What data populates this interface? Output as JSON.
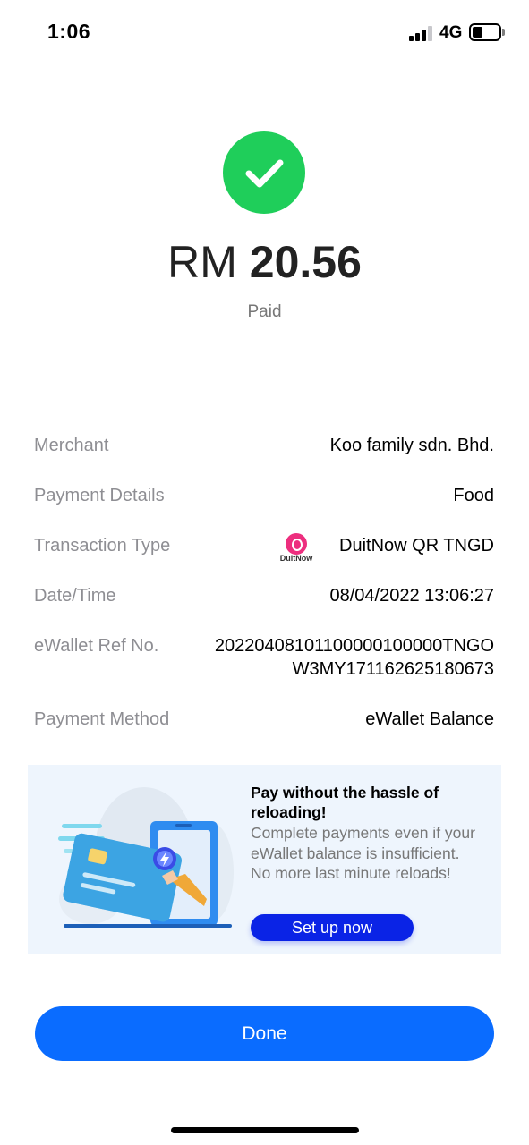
{
  "status_bar": {
    "time": "1:06",
    "network": "4G",
    "battery_level": 0.4
  },
  "payment": {
    "currency": "RM",
    "amount": "20.56",
    "status": "Paid"
  },
  "details": {
    "merchant_label": "Merchant",
    "merchant_value": "Koo family sdn. Bhd.",
    "payment_details_label": "Payment Details",
    "payment_details_value": "Food",
    "transaction_type_label": "Transaction Type",
    "transaction_type_logo_text": "DuitNow",
    "transaction_type_value": "DuitNow QR TNGD",
    "datetime_label": "Date/Time",
    "datetime_value": "08/04/2022 13:06:27",
    "ref_label": "eWallet Ref No.",
    "ref_value_line1": "20220408101100000100000TNGO",
    "ref_value_line2": "W3MY171162625180673",
    "method_label": "Payment Method",
    "method_value": "eWallet Balance"
  },
  "promo": {
    "title": "Pay without the hassle of reloading!",
    "body": "Complete payments even if your eWallet balance is insufficient. No more last minute reloads!",
    "button_label": "Set up now"
  },
  "done_label": "Done",
  "colors": {
    "success_green": "#1fce5a",
    "primary_blue": "#0a6cff",
    "promo_button_blue": "#0a23e6",
    "duitnow_pink": "#ed2e7e",
    "promo_background": "#eef5fd"
  }
}
